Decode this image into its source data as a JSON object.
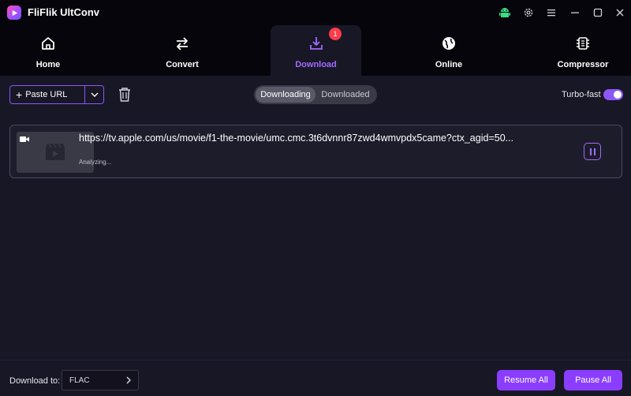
{
  "app": {
    "title": "FliFlik UltConv"
  },
  "titlebar": {
    "icons": [
      "android-icon",
      "settings-icon",
      "menu-icon",
      "minimize-icon",
      "maximize-icon",
      "close-icon"
    ]
  },
  "nav": {
    "items": [
      {
        "label": "Home",
        "icon": "home-icon"
      },
      {
        "label": "Convert",
        "icon": "convert-icon"
      },
      {
        "label": "Download",
        "icon": "download-icon",
        "active": true,
        "badge": "1"
      },
      {
        "label": "Online",
        "icon": "globe-icon"
      },
      {
        "label": "Compressor",
        "icon": "compressor-icon"
      }
    ]
  },
  "toolbar": {
    "paste_label": "Paste URL",
    "segments": [
      "Downloading",
      "Downloaded"
    ],
    "turbo_label": "Turbo-fast",
    "turbo_on": true
  },
  "downloads": [
    {
      "url": "https://tv.apple.com/us/movie/f1-the-movie/umc.cmc.3t6dvnnr87zwd4wmvpdx5came?ctx_agid=50...",
      "status": "Analyzing..."
    }
  ],
  "footer": {
    "download_to_label": "Download to:",
    "format": "FLAC",
    "resume_label": "Resume All",
    "pause_label": "Pause All"
  },
  "colors": {
    "accent": "#8b3dff",
    "accent_light": "#a26bff",
    "badge": "#ff3b4a",
    "background": "#0d0c17",
    "panel": "#181726"
  }
}
